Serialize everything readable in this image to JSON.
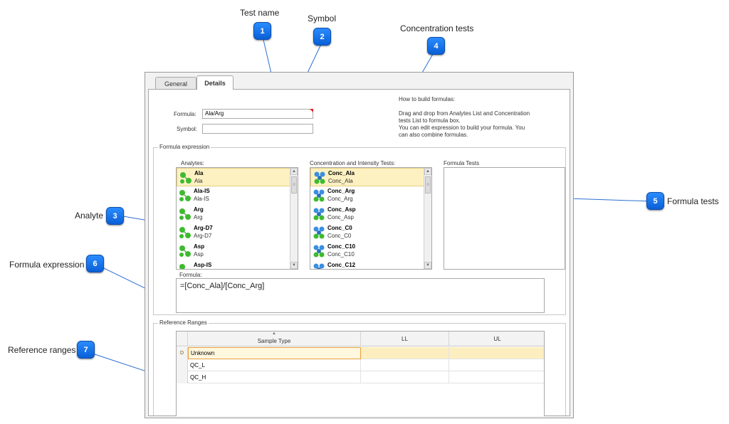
{
  "callouts": [
    {
      "num": "1",
      "label": "Test name"
    },
    {
      "num": "2",
      "label": "Symbol"
    },
    {
      "num": "3",
      "label": "Analyte"
    },
    {
      "num": "4",
      "label": "Concentration tests"
    },
    {
      "num": "5",
      "label": "Formula tests"
    },
    {
      "num": "6",
      "label": "Formula expression"
    },
    {
      "num": "7",
      "label": "Reference ranges"
    }
  ],
  "tabs": [
    {
      "label": "General"
    },
    {
      "label": "Details"
    }
  ],
  "form": {
    "formula_label": "Formula:",
    "formula_value": "Ala/Arg",
    "symbol_label": "Symbol:",
    "symbol_value": ""
  },
  "help": {
    "title": "How to build formulas:",
    "line1": "Drag and drop from Analytes List and Concentration",
    "line2": "tests List to formula box.",
    "line3": "You can edit expression to build your formula. You",
    "line4": "can also combine formulas."
  },
  "formula_expression": {
    "group_title": "Formula expression",
    "analytes_label": "Analytes:",
    "conc_label": "Concentration and Intensity Tests:",
    "formula_tests_label": "Formula Tests",
    "formula_label": "Formula:",
    "formula_value": "=[Conc_Ala]/[Conc_Arg]",
    "analytes": [
      {
        "name": "Ala",
        "sub": "Ala"
      },
      {
        "name": "Ala-IS",
        "sub": "Ala-IS"
      },
      {
        "name": "Arg",
        "sub": "Arg"
      },
      {
        "name": "Arg-D7",
        "sub": "Arg-D7"
      },
      {
        "name": "Asp",
        "sub": "Asp"
      },
      {
        "name": "Asp-IS",
        "sub": ""
      }
    ],
    "conc_tests": [
      {
        "name": "Conc_Ala",
        "sub": "Conc_Ala"
      },
      {
        "name": "Conc_Arg",
        "sub": "Conc_Arg"
      },
      {
        "name": "Conc_Asp",
        "sub": "Conc_Asp"
      },
      {
        "name": "Conc_C0",
        "sub": "Conc_C0"
      },
      {
        "name": "Conc_C10",
        "sub": "Conc_C10"
      },
      {
        "name": "Conc_C12",
        "sub": ""
      }
    ],
    "scroll_up": "▲",
    "scroll_down": "▼",
    "scroll_grip": "≡"
  },
  "reference_ranges": {
    "group_title": "Reference Ranges",
    "columns": [
      "Sample Type",
      "LL",
      "UL"
    ],
    "sort_indicator": "▲",
    "row_indicator": "D",
    "rows": [
      {
        "sample_type": "Unknown",
        "ll": "",
        "ul": ""
      },
      {
        "sample_type": "QC_L",
        "ll": "",
        "ul": ""
      },
      {
        "sample_type": "QC_H",
        "ll": "",
        "ul": ""
      }
    ]
  },
  "colors": {
    "badge": "#1a78f0",
    "selection": "#fdf1c2",
    "leader_line": "#2a6fd0",
    "molecule_green": "#3dbb2f",
    "molecule_blue": "#3a8fe0"
  },
  "icons": {
    "analyte": "molecule-green-icon",
    "concentration": "molecule-blue-green-icon"
  }
}
